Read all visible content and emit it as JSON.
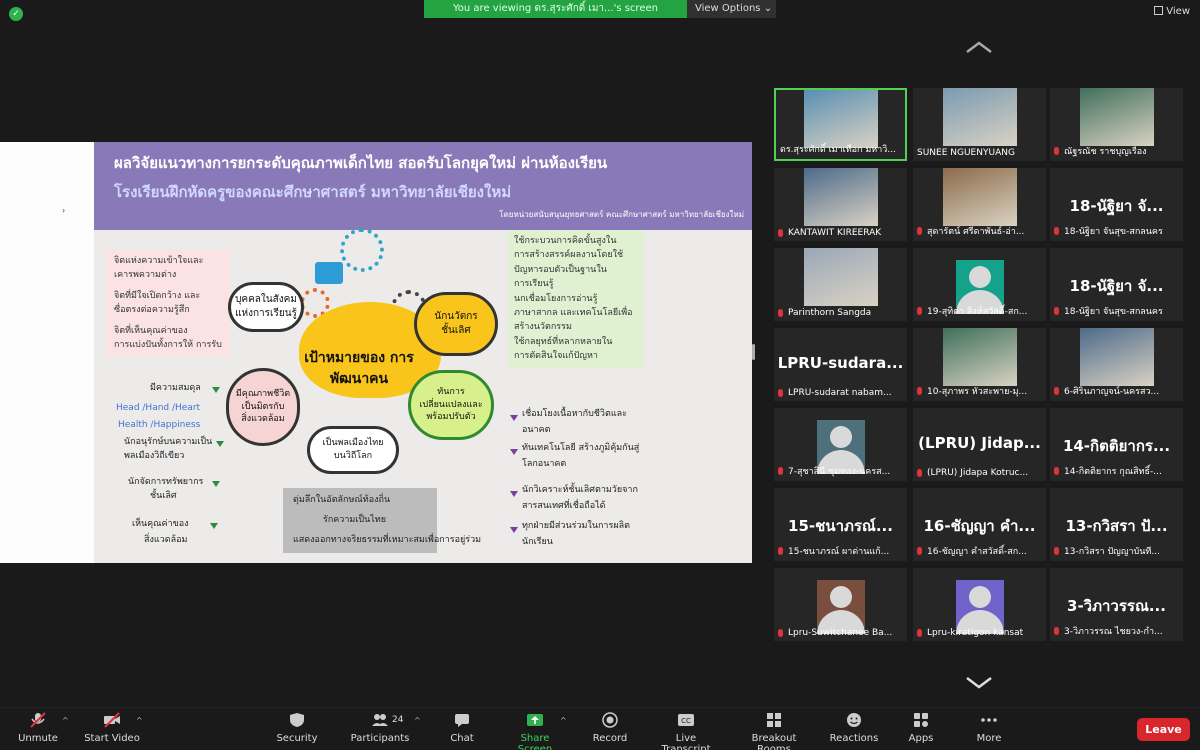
{
  "top": {
    "viewing_text": "You are viewing ดร.สุระศักดิ์ เมา...'s screen",
    "view_options": "View Options",
    "view_label": "View"
  },
  "slide": {
    "title1": "ผลวิจัยแนวทางการยกระดับคุณภาพเด็กไทย สอดรับโลกยุคใหม่ ผ่านห้องเรียน",
    "title2": "โรงเรียนฝึกหัดครูของคณะศึกษาศาสตร์ มหาวิทยาลัยเชียงใหม่",
    "title3": "โดยหน่วยสนับสนุนยุทธศาสตร์ คณะศึกษาศาสตร์ มหาวิทยาลัยเชียงใหม่",
    "pink_box": [
      "จิตแห่งความเข้าใจและ",
      "เคารพความต่าง",
      "จิตที่มีใจเปิดกว้าง และ",
      "ซื่อตรงต่อความรู้สึก",
      "จิตที่เห็นคุณค่าของ",
      "การแบ่งปันทั้งการให้ การรับ"
    ],
    "cloud_social": "บุคคลในสังคม\nแห่งการเรียนรู้",
    "cloud_innovator": "นักนวัตกร\nชั้นเลิศ",
    "cloud_quality": "มีคุณภาพชีวิต\nเป็นมิตรกับ\nสิ่งแวดล้อม",
    "cloud_change": "ทันการ\nเปลี่ยนแปลงและ\nพร้อมปรับตัว",
    "cloud_citizen": "เป็นพลเมืองไทย\nบนวิถีโลก",
    "goal": "เป้าหมายของ\nการพัฒนาคน",
    "left_list": {
      "balance": "มีความสมดุล",
      "hhh1": "Head /Hand /Heart",
      "hhh2": "Health /Happiness",
      "green_citizen1": "นักอนุรักษ์บนความเป็น",
      "green_citizen2": "พลเมืองวิถีเขียว",
      "resource1": "นักจัดการทรัพยากร",
      "resource2": "ชั้นเลิศ",
      "env1": "เห็นคุณค่าของ",
      "env2": "สิ่งแวดล้อม"
    },
    "green_box": [
      "ใช้กระบวนการคิดขั้นสูงใน",
      "การสร้างสรรค์ผลงานโดยใช้",
      "ปัญหารอบตัวเป็นฐานใน",
      "การเรียนรู้",
      "นกเชื่อมโยงการอ่านรู้",
      "ภาษาสากล และเทคโนโลยีเพื่อ",
      "สร้างนวัตกรรม",
      "ใช้กลยุทธ์ที่หลากหลายใน",
      "การตัดสินใจแก้ปัญหา"
    ],
    "right_list": [
      "เชื่อมโยงเนื้อหากับชีวิตและ",
      "อนาคต",
      "ทันเทคโนโลยี สร้างภูมิคุ้มกันสู่",
      "โลกอนาคต",
      "นักวิเคราะห์ชั้นเลิศตามวัยจาก",
      "สารสนเทศที่เชื่อถือได้",
      "ทุกฝ่ายมีส่วนร่วมในการผลิต",
      "นักเรียน"
    ],
    "gray_box": [
      "ดุ่มลึกในอัตลักษณ์ท้องถิ่น",
      "รักความเป็นไทย",
      "แสดงออกทางจริยธรรมที่เหมาะสมเพื่อการอยู่ร่วม"
    ]
  },
  "gallery": [
    {
      "label": "ดร.สุระศักดิ์ เมาเทือก มหาวิ...",
      "type": "video",
      "active": true
    },
    {
      "label": "SUNEE NGUENYUANG",
      "type": "video"
    },
    {
      "label": "ณัฐรณัช ราชบุญเรือง",
      "type": "video",
      "muted": true
    },
    {
      "label": "KANTAWIT KIREERAK",
      "type": "video",
      "muted": true
    },
    {
      "label": "สุดารัตน์ ศรีดาพันธ์-อ่า...",
      "type": "video",
      "muted": true
    },
    {
      "label": "18-นัฐิยา จันสุข-สกลนคร",
      "big": "18-นัฐิยา จั...",
      "type": "name",
      "muted": true
    },
    {
      "label": "Parinthorn Sangda",
      "type": "video",
      "muted": true
    },
    {
      "label": "19-สุทิตา สิงห์สวัสดิ์-สก...",
      "type": "avatar",
      "color": "#14a28b",
      "muted": true
    },
    {
      "label": "18-นัฐิยา จันสุข-สกลนคร",
      "big": "18-นัฐิยา จั...",
      "type": "name",
      "muted": true
    },
    {
      "label": "LPRU-sudarat nabam...",
      "big": "LPRU-sudara...",
      "type": "name",
      "muted": true
    },
    {
      "label": "10-สุภาพร หัวสะพาย-มุ...",
      "type": "video",
      "muted": true
    },
    {
      "label": "6-ศิรินภาญจน์-นครสว...",
      "type": "video",
      "muted": true
    },
    {
      "label": "7-สุชาสินี ชุมทอง-นครส...",
      "type": "avatar",
      "color": "#4e6f7c",
      "muted": true
    },
    {
      "label": "(LPRU) Jidapa Kotruc...",
      "big": "(LPRU) Jidap...",
      "type": "name",
      "muted": true
    },
    {
      "label": "14-กิตติยากร กุณสิทธิ์-...",
      "big": "14-กิตติยากร...",
      "type": "name",
      "muted": true
    },
    {
      "label": "15-ชนาภรณ์ ผาด่านแก้...",
      "big": "15-ชนาภรณ์...",
      "type": "name",
      "muted": true
    },
    {
      "label": "16-ชัญญา คำสวัสดิ์-สก...",
      "big": "16-ชัญญา คำ...",
      "type": "name",
      "muted": true
    },
    {
      "label": "13-กวิสรา ปัญญาบันที...",
      "big": "13-กวิสรา ปั...",
      "type": "name",
      "muted": true
    },
    {
      "label": "Lpru-Suwitchanee Ba...",
      "type": "avatar",
      "color": "#7a4e3f",
      "muted": true
    },
    {
      "label": "Lpru-kiratigon kansat",
      "type": "avatar",
      "color": "#6f63c9",
      "muted": true
    },
    {
      "label": "3-วิภาวรรณ ไชยวง-กำ...",
      "big": "3-วิภาวรรณ...",
      "type": "name",
      "muted": true
    }
  ],
  "toolbar": {
    "unmute": "Unmute",
    "start_video": "Start Video",
    "security": "Security",
    "participants": "Participants",
    "participants_count": "24",
    "chat": "Chat",
    "share_screen": "Share Screen",
    "record": "Record",
    "live_transcript": "Live Transcript",
    "breakout_rooms": "Breakout Rooms",
    "reactions": "Reactions",
    "apps": "Apps",
    "more": "More",
    "leave": "Leave"
  },
  "colors": {
    "accent_green": "#23a341",
    "leave_red": "#d9262c",
    "banner_purple": "#8a79b8"
  }
}
